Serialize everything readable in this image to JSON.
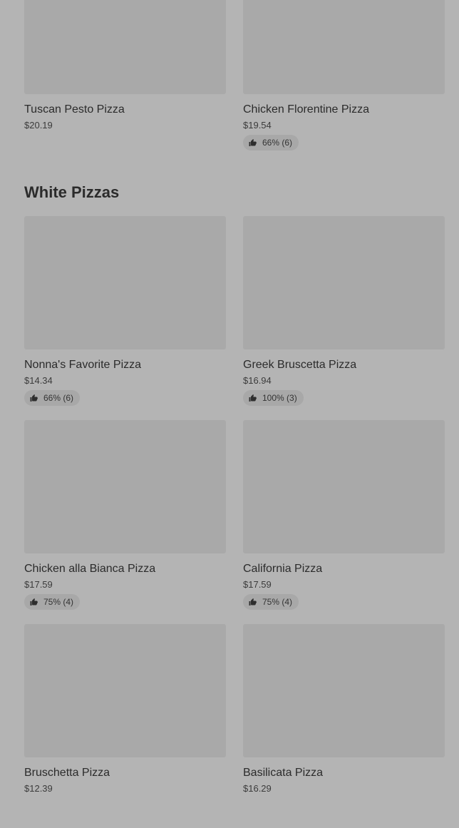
{
  "top_items": [
    {
      "name": "Tuscan Pesto Pizza",
      "price": "$20.19",
      "rating": ""
    },
    {
      "name": "Chicken Florentine Pizza",
      "price": "$19.54",
      "rating": "66% (6)"
    }
  ],
  "section": {
    "title": "White Pizzas"
  },
  "items": [
    {
      "name": "Nonna's Favorite Pizza",
      "price": "$14.34",
      "rating": "66% (6)"
    },
    {
      "name": "Greek Bruscetta Pizza",
      "price": "$16.94",
      "rating": "100% (3)"
    },
    {
      "name": "Chicken alla Bianca Pizza",
      "price": "$17.59",
      "rating": "75% (4)"
    },
    {
      "name": "California Pizza",
      "price": "$17.59",
      "rating": "75% (4)"
    },
    {
      "name": "Bruschetta Pizza",
      "price": "$12.39",
      "rating": ""
    },
    {
      "name": "Basilicata Pizza",
      "price": "$16.29",
      "rating": ""
    }
  ],
  "icons": {
    "rating": "thumbs-up-icon"
  }
}
